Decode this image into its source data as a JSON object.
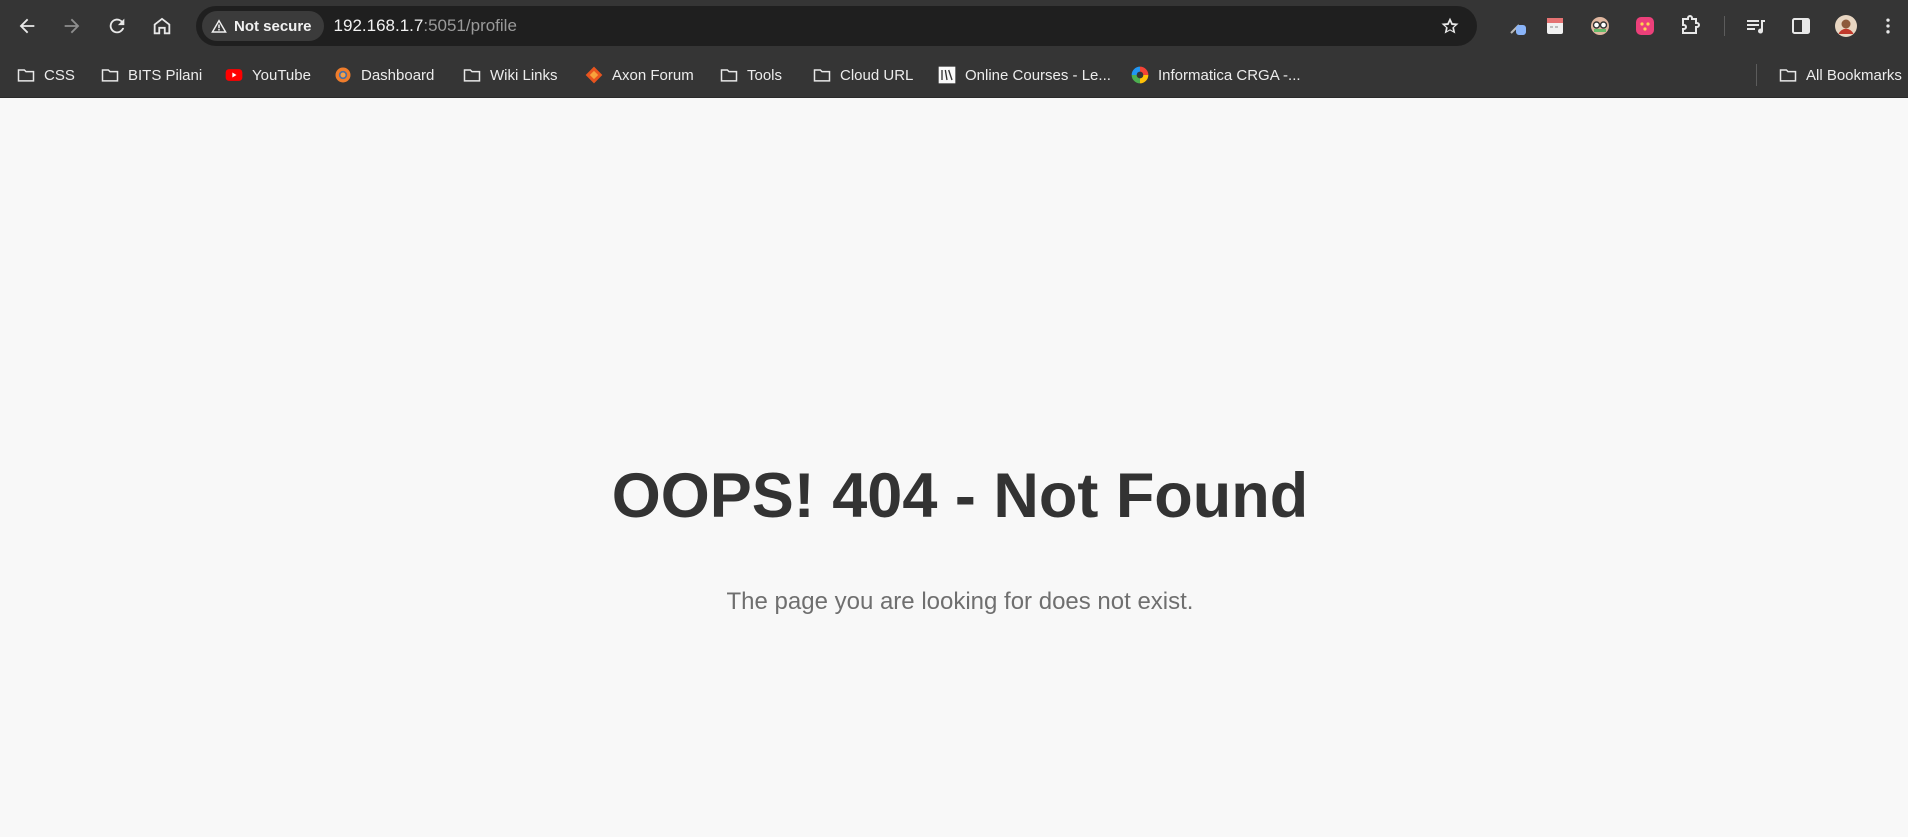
{
  "toolbar": {
    "security_label": "Not secure",
    "url_host": "192.168.1.7",
    "url_rest": ":5051/profile"
  },
  "bookmarks": [
    {
      "label": "CSS",
      "icon": "folder-icon"
    },
    {
      "label": "BITS Pilani",
      "icon": "folder-icon"
    },
    {
      "label": "YouTube",
      "icon": "youtube-icon"
    },
    {
      "label": "Dashboard",
      "icon": "dashboard-icon"
    },
    {
      "label": "Wiki Links",
      "icon": "folder-icon"
    },
    {
      "label": "Axon Forum",
      "icon": "axon-icon"
    },
    {
      "label": "Tools",
      "icon": "folder-icon"
    },
    {
      "label": "Cloud URL",
      "icon": "folder-icon"
    },
    {
      "label": "Online Courses - Le...",
      "icon": "course-icon"
    },
    {
      "label": "Informatica CRGA -...",
      "icon": "informatica-icon"
    }
  ],
  "all_bookmarks_label": "All Bookmarks",
  "page": {
    "heading": "OOPS! 404 - Not Found",
    "message": "The page you are looking for does not exist."
  },
  "colors": {
    "toolbar_bg": "#353535",
    "omnibox_bg": "#1f1f1f",
    "page_bg": "#f8f8f8",
    "heading": "#333333",
    "message": "#6f6f6f"
  }
}
